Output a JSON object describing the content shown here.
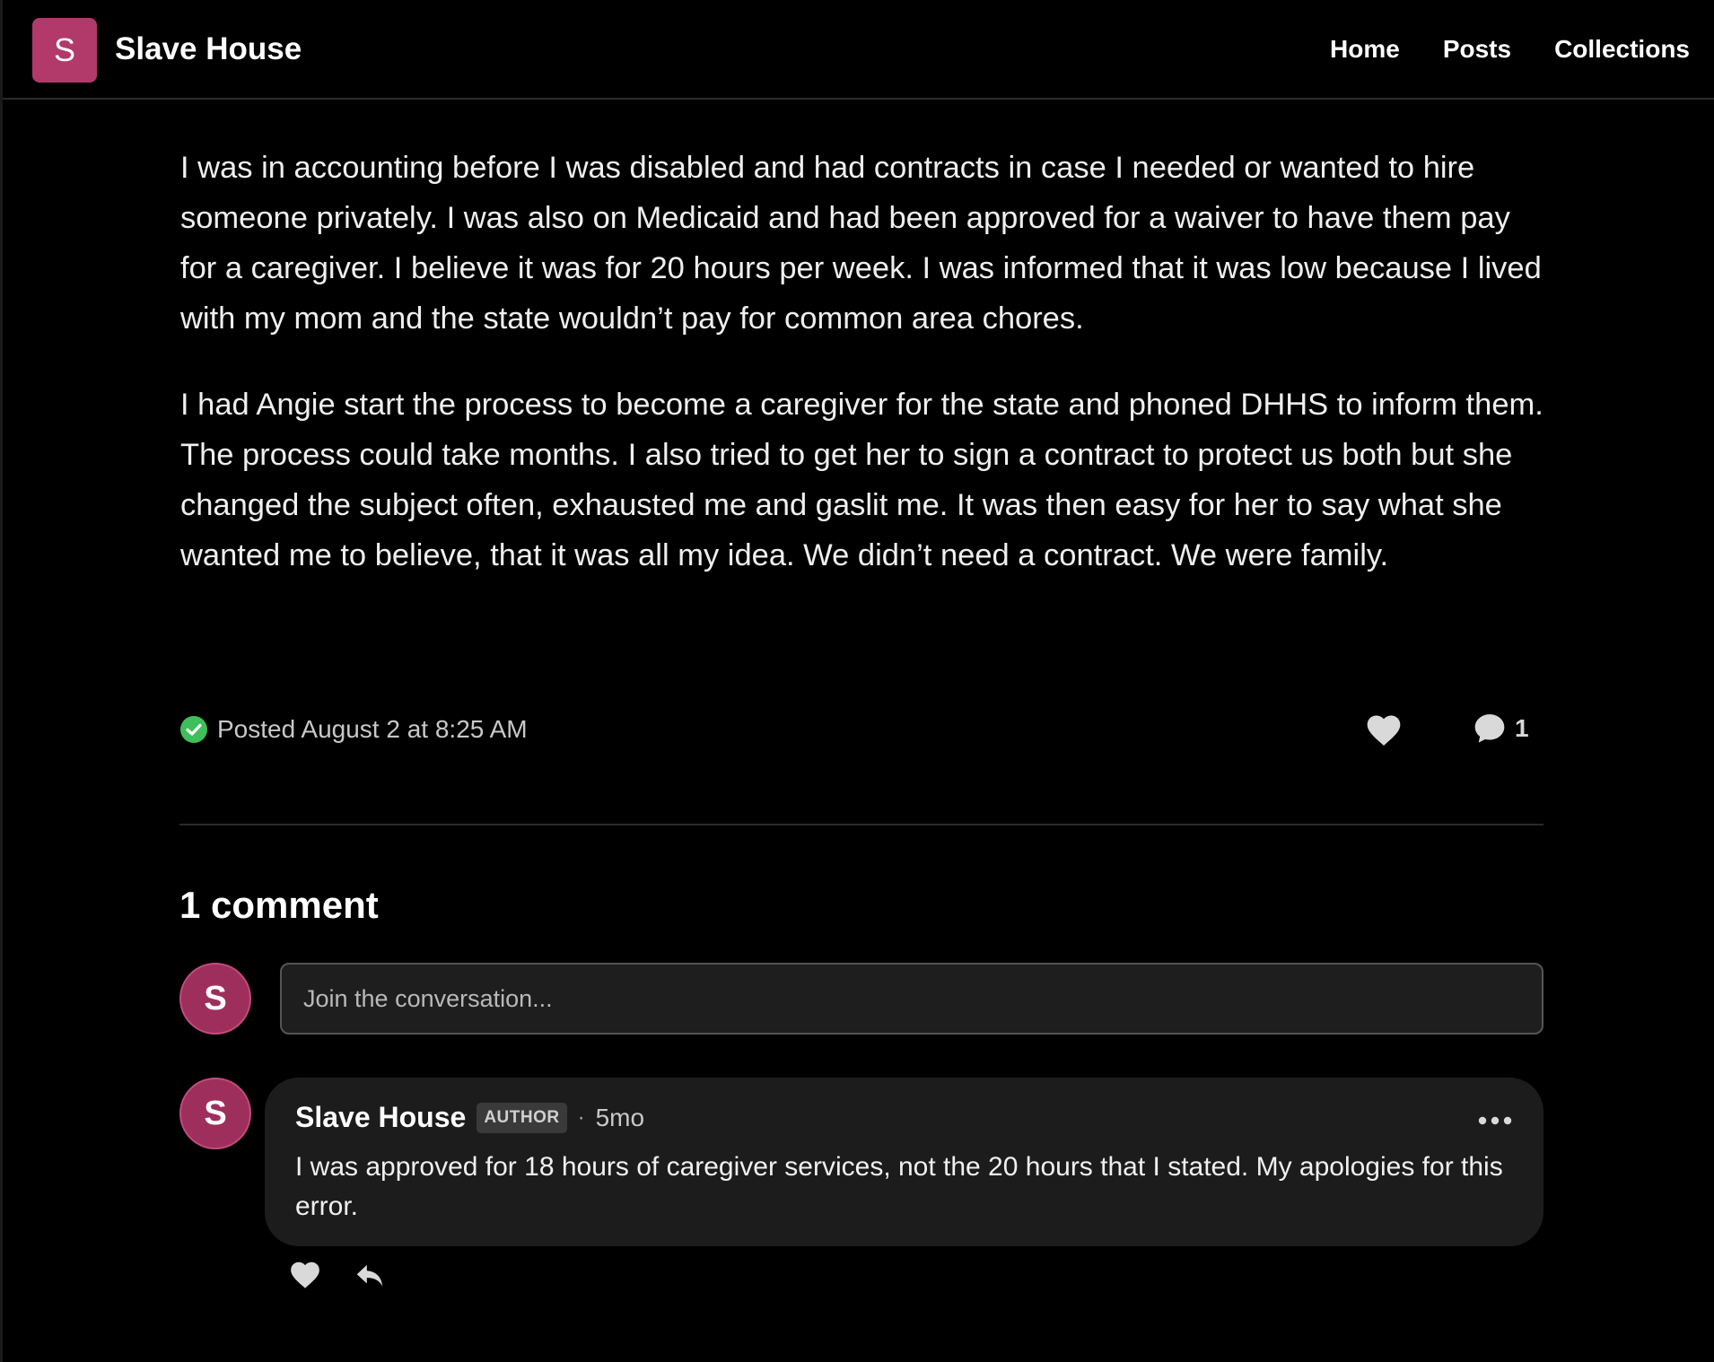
{
  "header": {
    "logo_letter": "S",
    "site_name": "Slave House",
    "nav": [
      {
        "label": "Home"
      },
      {
        "label": "Posts"
      },
      {
        "label": "Collections"
      }
    ]
  },
  "post": {
    "paragraphs": [
      "I was in accounting before I was disabled and had contracts in case I needed or wanted to hire someone privately. I was also on Medicaid and had been approved for a waiver to have them pay for a caregiver. I believe it was for 20 hours per week. I was informed that it was low because I lived with my mom and the state wouldn’t pay for common area chores.",
      "I had Angie start the process to become a caregiver for the state and phoned DHHS to inform them. The process could take months. I also tried to get her to sign a contract to protect us both but she changed the subject often, exhausted me and gaslit me. It was then easy for her to say what she wanted me to believe, that it was all my idea. We didn’t need a contract. We were family."
    ],
    "posted_text": "Posted August 2 at 8:25 AM",
    "comment_count": "1"
  },
  "comments_section": {
    "heading": "1 comment",
    "composer": {
      "avatar_letter": "S",
      "placeholder": "Join the conversation..."
    },
    "comments": [
      {
        "avatar_letter": "S",
        "author": "Slave House",
        "badge": "AUTHOR",
        "separator": "·",
        "time": "5mo",
        "text": "I was approved for 18 hours of caregiver services, not the 20 hours that I stated.  My apologies for this error."
      }
    ]
  },
  "colors": {
    "accent": "#b13a6b",
    "avatar": "#9e2f5d",
    "check": "#3fbf5b",
    "icon": "#d9d9d9",
    "background": "#000000",
    "bubble": "#1c1c1c"
  },
  "icons": {
    "posted": "check-circle-icon",
    "like": "heart-icon",
    "comments": "speech-bubble-icon",
    "more": "ellipsis-icon",
    "reply": "reply-arrow-icon"
  }
}
